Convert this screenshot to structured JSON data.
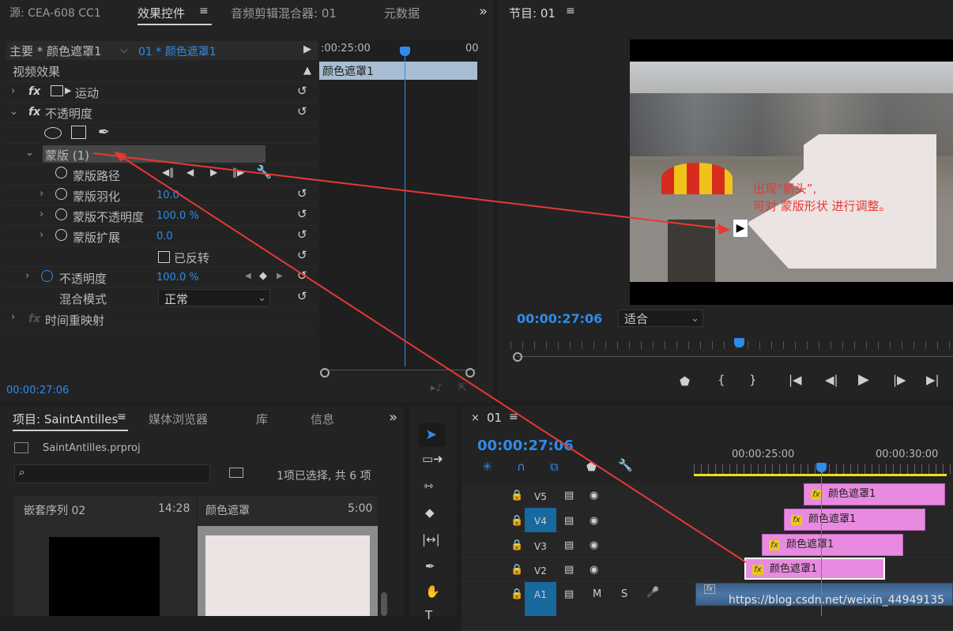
{
  "top_tabs": {
    "source": "源: CEA-608 CC1",
    "effect_controls": "效果控件",
    "audio_mixer": "音频剪辑混合器: 01",
    "metadata": "元数据",
    "more": "»"
  },
  "effect_controls": {
    "master": "主要 * 颜色遮罩1",
    "clip": "01 * 颜色遮罩1",
    "timecode_ruler": ":00:25:00",
    "ruler_end": "00",
    "clip_bar": "颜色遮罩1",
    "section": "视频效果",
    "motion": "运动",
    "opacity": "不透明度",
    "mask": "蒙版 (1)",
    "mask_path": "蒙版路径",
    "mask_feather": "蒙版羽化",
    "mask_feather_val": "10.0",
    "mask_opacity": "蒙版不透明度",
    "mask_opacity_val": "100.0 %",
    "mask_expand": "蒙版扩展",
    "mask_expand_val": "0.0",
    "inverted": "已反转",
    "opacity2": "不透明度",
    "opacity2_val": "100.0 %",
    "blend_mode": "混合模式",
    "blend_value": "正常",
    "time_remap": "时间重映射",
    "timecode": "00:00:27:06"
  },
  "program": {
    "title": "节目: 01",
    "timecode": "00:00:27:06",
    "fit": "适合",
    "annotation_line1": "出现“箭头”,",
    "annotation_line2": "可对 蒙版形状 进行调整。"
  },
  "project": {
    "tab_project": "项目: SaintAntilles",
    "tab_media": "媒体浏览器",
    "tab_library": "库",
    "tab_info": "信息",
    "file": "SaintAntilles.prproj",
    "selection": "1项已选择, 共 6 项",
    "item1_name": "嵌套序列 02",
    "item1_dur": "14:28",
    "item2_name": "颜色遮罩",
    "item2_dur": "5:00"
  },
  "timeline": {
    "tab": "01",
    "timecode": "00:00:27:06",
    "ruler1": "00:00:25:00",
    "ruler2": "00:00:30:00",
    "tracks": [
      "V5",
      "V4",
      "V3",
      "V2",
      "A1"
    ],
    "clip_label": "颜色遮罩1",
    "m": "M",
    "s": "S"
  },
  "watermark": "https://blog.csdn.net/weixin_44949135",
  "colors": {
    "accent": "#2d8ceb",
    "clip": "#e88be0",
    "arrow": "#e53935"
  }
}
